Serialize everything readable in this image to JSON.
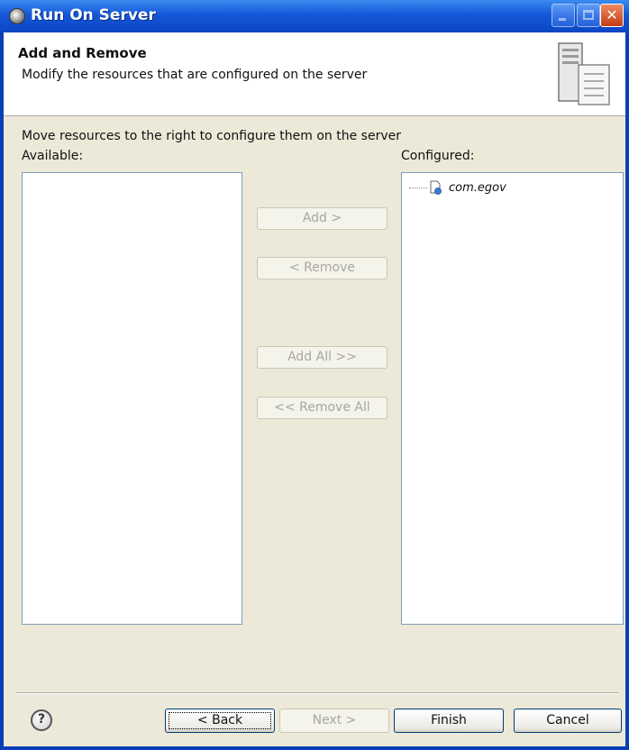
{
  "window": {
    "title": "Run On Server"
  },
  "banner": {
    "title": "Add and Remove",
    "description": "Modify the resources that are configured on the server",
    "icon": "server-wizard-icon"
  },
  "content": {
    "instruction": "Move resources to the right to configure them on the server",
    "available_label": "Available:",
    "configured_label": "Configured:",
    "available_items": [],
    "configured_items": [
      {
        "label": "com.egov",
        "icon": "web-project-icon"
      }
    ]
  },
  "move_buttons": {
    "add": "Add >",
    "remove": "< Remove",
    "add_all": "Add All >>",
    "remove_all": "<< Remove All"
  },
  "footer": {
    "help_glyph": "?",
    "back": "< Back",
    "next": "Next >",
    "finish": "Finish",
    "cancel": "Cancel"
  },
  "colors": {
    "titlebar": "#1557d8",
    "dialog_bg": "#ece9d8",
    "list_border": "#7f9db9"
  }
}
